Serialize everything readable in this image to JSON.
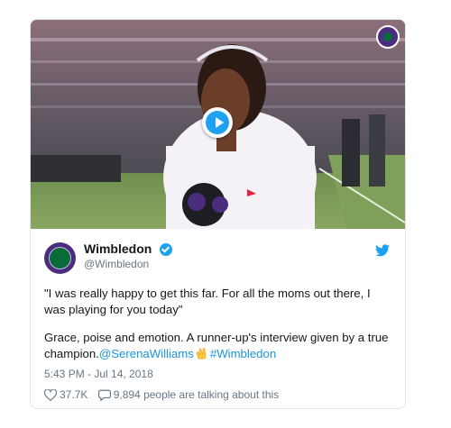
{
  "tweet": {
    "name": "Wimbledon",
    "handle": "@Wimbledon",
    "quote": "\"I was really happy to get this far. For all the moms out there, I was playing for you today\"",
    "body_text": "Grace, poise and emotion. A runner-up's interview given by a true champion.",
    "mention": "@SerenaWilliams",
    "hashtag": "#Wimbledon",
    "timestamp": "5:43 PM - Jul 14, 2018",
    "likes": "37.7K",
    "talking": "9,894 people are talking about this"
  },
  "icons": {
    "play": "play-icon",
    "verified": "verified-badge-icon",
    "bird": "twitter-bird-icon",
    "heart": "heart-icon",
    "comment": "comment-icon",
    "clap": "clapping-hands-emoji",
    "logo": "wimbledon-logo-icon"
  },
  "colors": {
    "accent": "#1da1f2",
    "link": "#1b95e0",
    "brand_purple": "#4b2d7f",
    "brand_green": "#0a6b3a",
    "muted": "#657786"
  }
}
